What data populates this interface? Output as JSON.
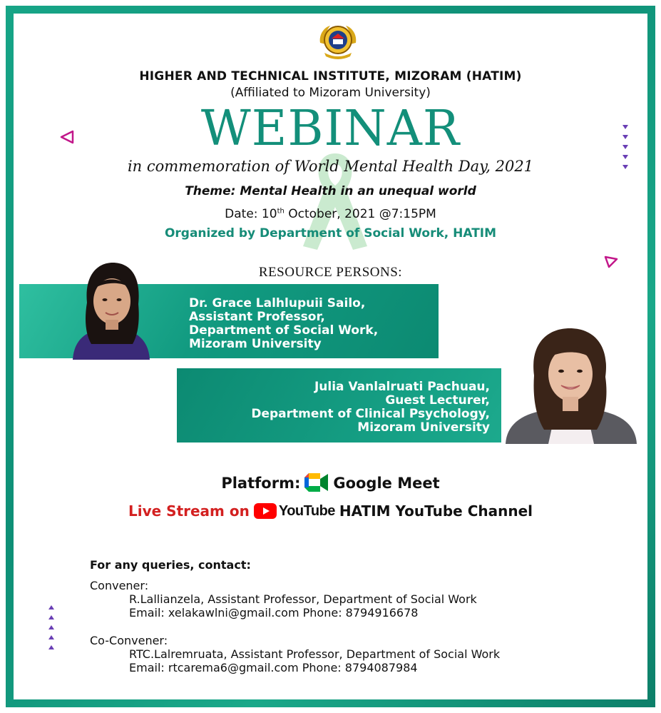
{
  "institute": {
    "name": "HIGHER AND TECHNICAL INSTITUTE, MIZORAM (HATIM)",
    "affiliation": "(Affiliated to Mizoram University)"
  },
  "event": {
    "title": "WEBINAR",
    "subtitle": "in commemoration of World Mental Health Day, 2021",
    "theme": "Theme: Mental Health in an unequal world",
    "date_prefix": "Date: 10",
    "date_sup": "th",
    "date_suffix": " October, 2021 @7:15PM",
    "organizer": "Organized by Department of Social Work, HATIM"
  },
  "resource_persons": {
    "heading": "RESOURCE PERSONS:",
    "people": [
      {
        "name": "Dr. Grace Lalhlupuii Sailo,",
        "role": "Assistant Professor,",
        "department": "Department of Social Work,",
        "institution": "Mizoram University"
      },
      {
        "name": "Julia Vanlalruati Pachuau,",
        "role": "Guest Lecturer,",
        "department": "Department of Clinical Psychology,",
        "institution": "Mizoram University"
      }
    ]
  },
  "platform": {
    "label": "Platform:",
    "service": "Google Meet",
    "icon": "google-meet-icon"
  },
  "livestream": {
    "prefix": "Live Stream on",
    "brand": "YouTube",
    "channel": "HATIM YouTube Channel",
    "icon": "youtube-icon"
  },
  "contacts": {
    "heading": "For any queries, contact:",
    "convener": {
      "label": "Convener:",
      "detail": "R.Lallianzela, Assistant Professor, Department of Social Work",
      "email_phone": "Email: xelakawlni@gmail.com Phone: 8794916678"
    },
    "co_convener": {
      "label": "Co-Convener:",
      "detail": "RTC.Lalremruata, Assistant Professor, Department of Social Work",
      "email_phone": "Email: rtcarema6@gmail.com Phone: 8794087984"
    }
  },
  "colors": {
    "teal": "#138f7a",
    "frame": "#17a587",
    "red": "#d32020",
    "purple": "#6a3fb5",
    "pink": "#c2178a"
  }
}
